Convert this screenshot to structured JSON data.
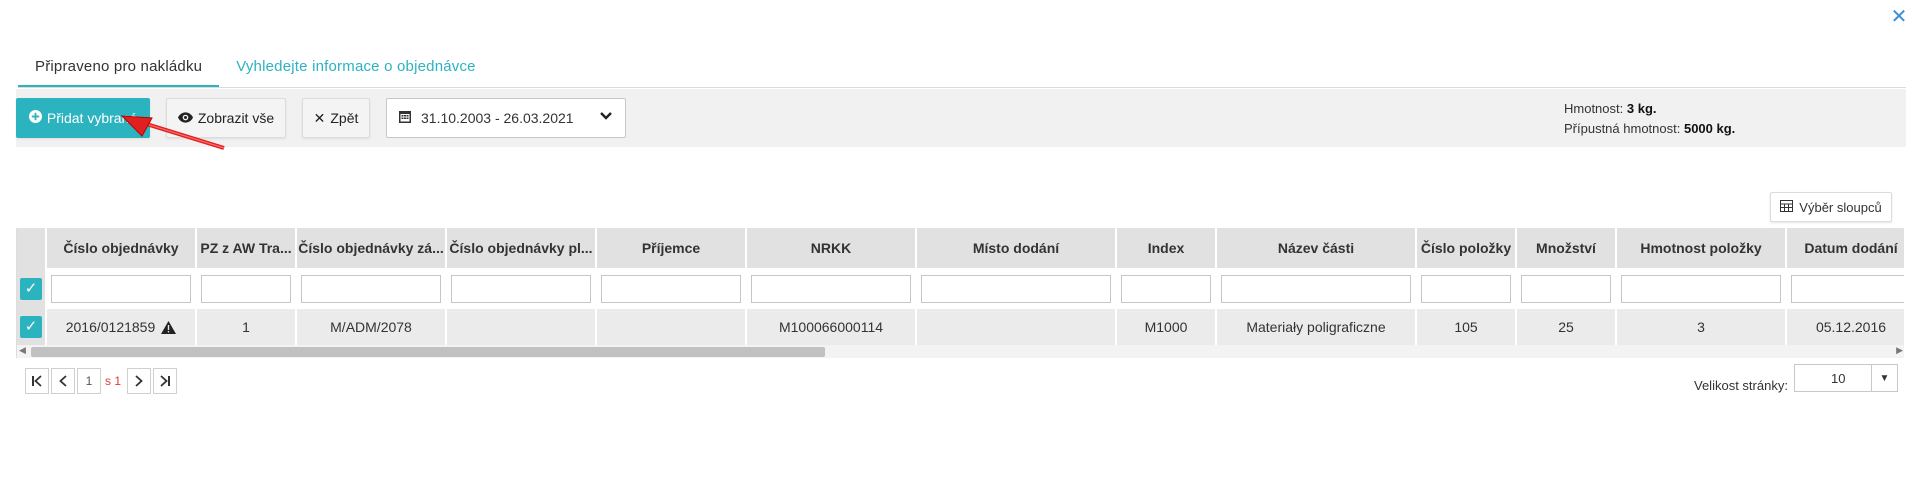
{
  "close_icon": "close-icon",
  "tabs": [
    {
      "label": "Připraveno pro nakládku",
      "active": true
    },
    {
      "label": "Vyhledejte informace o objednávce",
      "active": false
    }
  ],
  "toolbar": {
    "add_selected_label": "Přidat vybrané",
    "show_all_label": "Zobrazit vše",
    "back_label": "Zpět",
    "date_range": "31.10.2003 - 26.03.2021",
    "weight_label": "Hmotnost:",
    "weight_value": "3 kg.",
    "allowed_weight_label": "Přípustná hmotnost:",
    "allowed_weight_value": "5000 kg."
  },
  "column_selector_label": "Výběr sloupců",
  "grid": {
    "columns": [
      "Číslo objednávky",
      "PZ z AW Transfer",
      "Číslo objednávky zákazníka",
      "Číslo objednávky plátce",
      "Příjemce",
      "NRKK",
      "Místo dodání",
      "Index",
      "Název části",
      "Číslo položky",
      "Množství",
      "Hmotnost položky",
      "Datum dodání"
    ],
    "columns_display": [
      "Číslo objednávky",
      "PZ z AW Tra...",
      "Číslo objednávky zá...",
      "Číslo objednávky pl...",
      "Příjemce",
      "NRKK",
      "Místo dodání",
      "Index",
      "Název části",
      "Číslo položky",
      "Množství",
      "Hmotnost položky",
      "Datum dodání"
    ],
    "rows": [
      {
        "selected": true,
        "warning": true,
        "cells": [
          "2016/0121859",
          "1",
          "M/ADM/2078",
          "",
          "",
          "M100066000114",
          "",
          "M1000",
          "Materiały poligraficzne",
          "105",
          "25",
          "3",
          "05.12.2016"
        ]
      }
    ]
  },
  "pager": {
    "current_page": "1",
    "of_text": "s 1",
    "page_size_label": "Velikost stránky:",
    "page_size": "10"
  },
  "colors": {
    "accent": "#2cb3c0",
    "link": "#3a8fd6",
    "header_bg": "#e1e1e1",
    "row_bg": "#ebebeb",
    "annotation_arrow": "#e02020"
  }
}
